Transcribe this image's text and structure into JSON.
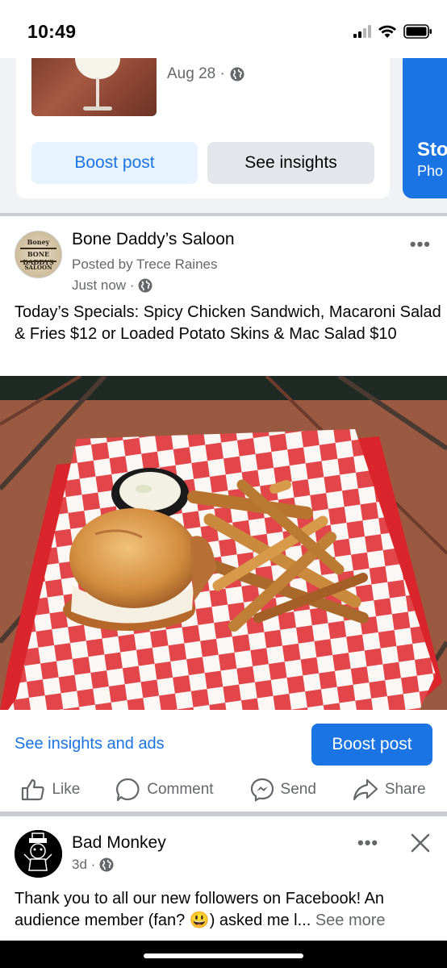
{
  "status_bar": {
    "time": "10:49"
  },
  "previous_post": {
    "date": "Aug 28 ·",
    "boost_label": "Boost post",
    "insights_label": "See insights"
  },
  "story_card": {
    "title": "Sto",
    "subtitle": "Pho"
  },
  "post": {
    "page_name": "Bone Daddy’s Saloon",
    "posted_by": "Posted by Trece Raines",
    "timestamp": "Just now ·",
    "text": "Today’s Specials: Spicy Chicken Sandwich, Macaroni Salad & Fries $12 or Loaded Potato Skins & Mac Salad $10",
    "avatar_text": {
      "top": "Boney",
      "middle": "BONE DADDYS",
      "bottom": "SALOON"
    },
    "see_insights_ads": "See insights and ads",
    "boost_label": "Boost post",
    "actions": {
      "like": "Like",
      "comment": "Comment",
      "send": "Send",
      "share": "Share"
    }
  },
  "next_post": {
    "page_name": "Bad Monkey",
    "timestamp": "3d ·",
    "text_main": "Thank you to all our new followers on Facebook! An audience member (fan? 😃) asked me l... ",
    "see_more": "See more"
  },
  "colors": {
    "accent": "#1b74e4",
    "light_accent_bg": "#e7f3ff",
    "secondary_text": "#65676b"
  }
}
